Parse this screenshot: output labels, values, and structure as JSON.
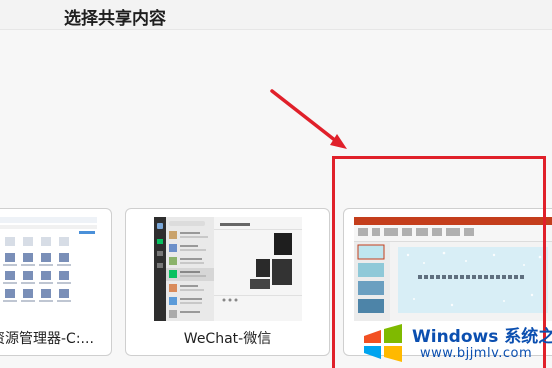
{
  "dialog": {
    "title": "选择共享内容"
  },
  "windows": [
    {
      "label": "资源管理器-C:..."
    },
    {
      "label": "WeChat-微信"
    },
    {
      "label": ""
    }
  ],
  "watermark": {
    "brand": "Windows",
    "suffix": "系统之家",
    "url": "www.bjjmlv.com"
  },
  "colors": {
    "highlight": "#e0202a",
    "watermark_blue": "#0b4fb0",
    "wechat_green": "#07c160",
    "ppt_orange": "#c43e1c"
  }
}
